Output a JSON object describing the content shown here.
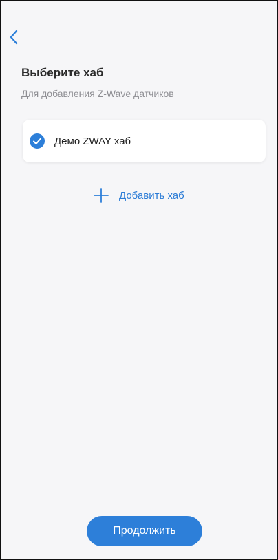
{
  "header": {
    "back_icon": "chevron-left-icon",
    "title": "Выберите хаб",
    "subtitle": "Для добавления Z-Wave датчиков"
  },
  "hubs": [
    {
      "name": "Демо ZWAY хаб",
      "selected": true,
      "icon": "check-circle-icon"
    }
  ],
  "add_hub": {
    "icon": "plus-icon",
    "label": "Добавить хаб"
  },
  "footer": {
    "continue_label": "Продолжить"
  },
  "colors": {
    "accent": "#2d7fd9",
    "link": "#2a7bd6",
    "background": "#f6f6f8",
    "card": "#ffffff",
    "title_text": "#2b2b2b",
    "subtitle_text": "#8f8f94"
  }
}
